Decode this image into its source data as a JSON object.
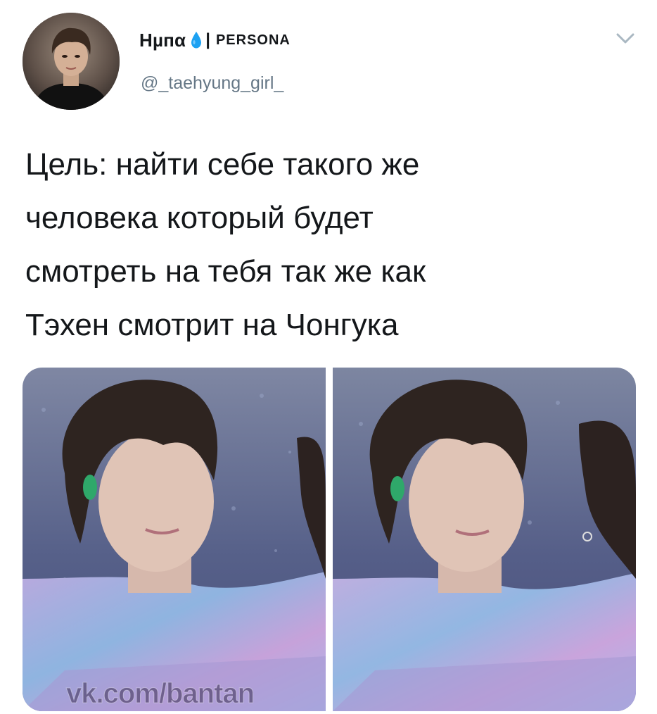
{
  "tweet": {
    "display_name": "Нµпα",
    "name_separator": "|",
    "name_suffix": "PERSONA",
    "handle": "@_taehyung_girl_",
    "text": "Цель: найти себе такого же\nчеловека который будет\nсмотреть на тебя так же как\nТэхен смотрит на Чонгука",
    "emoji_icon": "blue-droplet",
    "menu_icon": "chevron-down",
    "media": {
      "count": 2,
      "watermark": "vk.com/bantan"
    }
  },
  "colors": {
    "text": "#14171a",
    "secondary_text": "#657786",
    "droplet": "#1da1f2",
    "caret": "#aab8c2"
  }
}
